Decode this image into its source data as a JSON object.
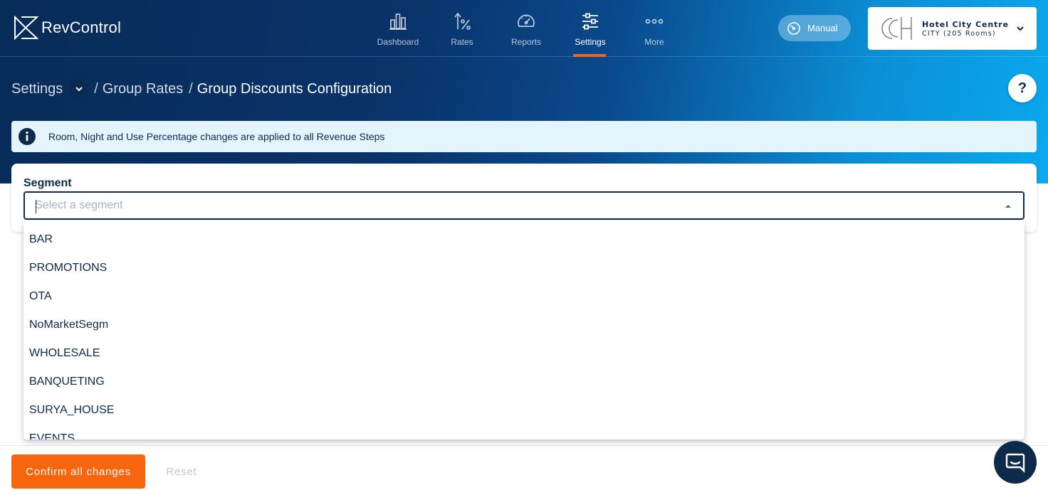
{
  "brand": {
    "name": "RevControl"
  },
  "nav": {
    "items": [
      {
        "label": "Dashboard",
        "icon": "bar-chart-icon"
      },
      {
        "label": "Rates",
        "icon": "rates-percent-icon"
      },
      {
        "label": "Reports",
        "icon": "speedometer-icon"
      },
      {
        "label": "Settings",
        "icon": "sliders-icon",
        "active": true
      },
      {
        "label": "More",
        "icon": "more-dots-icon"
      }
    ]
  },
  "mode": {
    "label": "Manual"
  },
  "hotel": {
    "name": "Hotel City Centre",
    "subtitle": "CITY (205 Rooms)"
  },
  "breadcrumb": {
    "root": "Settings",
    "separator": "/",
    "group": "Group Rates",
    "current": "Group Discounts Configuration"
  },
  "help": {
    "label": "?"
  },
  "info": {
    "message": "Room, Night and Use Percentage changes are applied to all Revenue Steps"
  },
  "segment": {
    "label": "Segment",
    "placeholder": "Select a segment",
    "value": "",
    "options": [
      "BAR",
      "PROMOTIONS",
      "OTA",
      "NoMarketSegm",
      "WHOLESALE",
      "BANQUETING",
      "SURYA_HOUSE",
      "EVENTS"
    ]
  },
  "footer": {
    "confirm_label": "Confirm all changes",
    "reset_label": "Reset"
  },
  "colors": {
    "accent": "#f7650f",
    "primary": "#0d2a4a",
    "info_bg": "#e3f4fd"
  }
}
